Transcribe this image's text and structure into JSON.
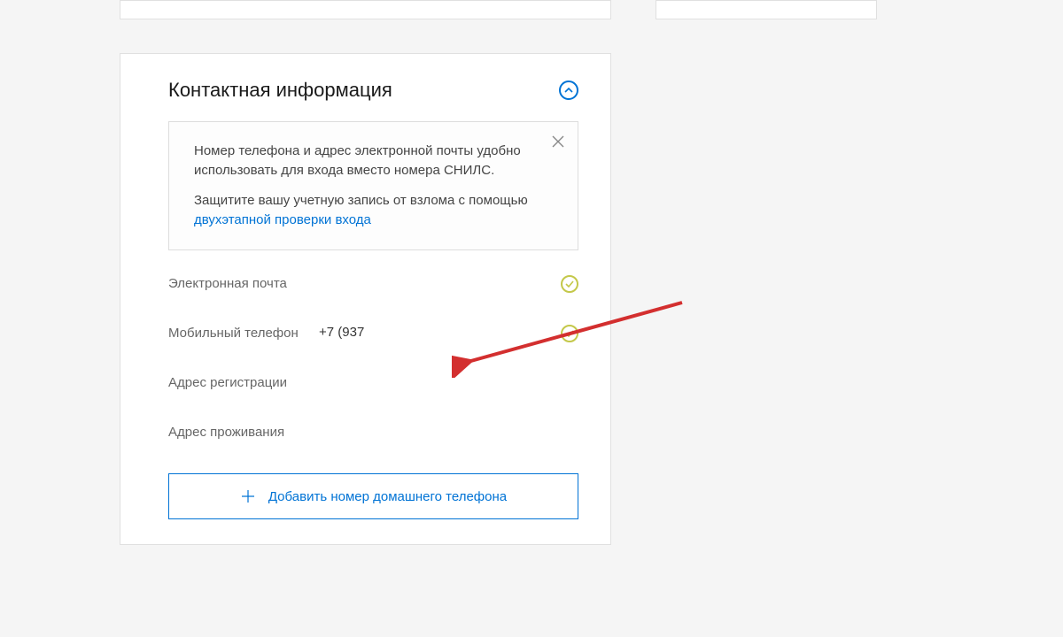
{
  "card": {
    "title": "Контактная информация",
    "info": {
      "line1": "Номер телефона и адрес электронной почты удобно использовать для входа вместо номера СНИЛС.",
      "line2_prefix": "Защитите вашу учетную запись от взлома с помощью ",
      "line2_link": "двухэтапной проверки входа"
    },
    "fields": {
      "email_label": "Электронная почта",
      "email_value": "",
      "phone_label": "Мобильный телефон",
      "phone_value": "+7 (937",
      "reg_addr_label": "Адрес регистрации",
      "reg_addr_value": "",
      "live_addr_label": "Адрес проживания",
      "live_addr_value": ""
    },
    "actions": {
      "add_home_phone": "Добавить номер домашнего телефона"
    }
  },
  "colors": {
    "accent": "#0073d5",
    "verified_ring": "#c4c84a",
    "annotation": "#d32f2f"
  }
}
